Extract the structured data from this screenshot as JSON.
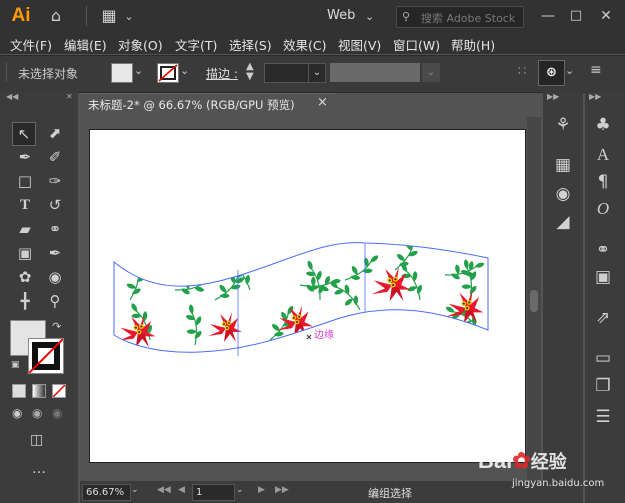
{
  "app": {
    "logo_text": "Ai",
    "workspace": "Web",
    "search_placeholder": "搜索 Adobe Stock"
  },
  "menus": [
    "文件(F)",
    "编辑(E)",
    "对象(O)",
    "文字(T)",
    "选择(S)",
    "效果(C)",
    "视图(V)",
    "窗口(W)",
    "帮助(H)"
  ],
  "control": {
    "no_selection": "未选择对象",
    "stroke_label": "描边 :"
  },
  "document": {
    "tab_title": "未标题-2* @ 66.67% (RGB/GPU 预览)",
    "close_glyph": "×"
  },
  "canvas": {
    "annotation": "边缘"
  },
  "status": {
    "zoom": "66.67%",
    "artboard_number": "1",
    "tool_status": "编组选择"
  },
  "watermark": {
    "brand": "Bai",
    "brand2": "经验",
    "url": "jingyan.baidu.com"
  },
  "colors": {
    "accent": "#ff9a00",
    "ui_dark": "#323232",
    "panel": "#3c3c3c",
    "leaf": "#22a04a",
    "flower": "#e8192c",
    "path": "#4a6cff"
  }
}
